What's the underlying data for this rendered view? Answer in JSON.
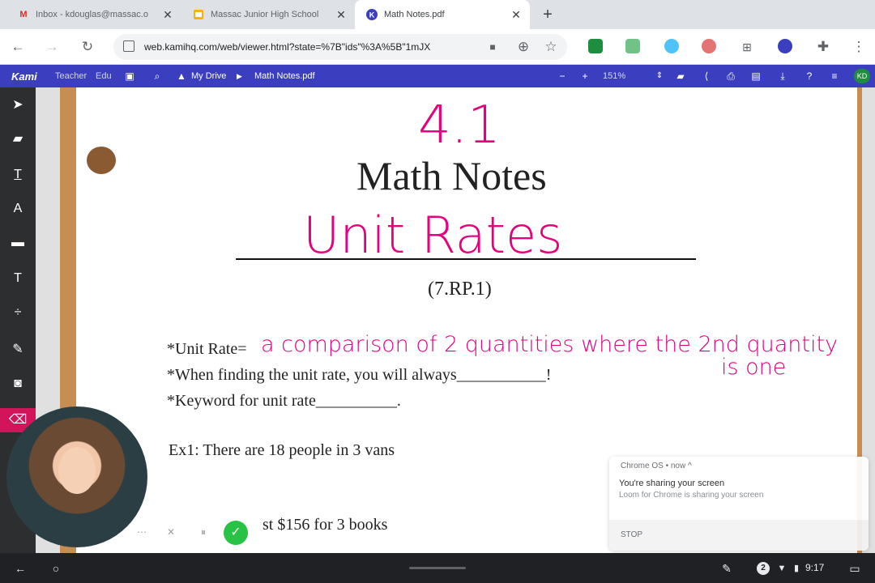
{
  "browser": {
    "tabs": [
      {
        "title": "Inbox - kdouglas@massac.o",
        "icon": "gmail-icon",
        "active": false
      },
      {
        "title": "Massac Junior High School",
        "icon": "google-sites-icon",
        "active": false
      },
      {
        "title": "Math Notes.pdf",
        "icon": "kami-icon",
        "active": true
      }
    ],
    "url": "web.kamihq.com/web/viewer.html?state=%7B\"ids\"%3A%5B\"1mJX"
  },
  "kami": {
    "logo": "Kami",
    "mode_teacher": "Teacher",
    "mode_edu": "Edu",
    "breadcrumb_root": "My Drive",
    "breadcrumb_file": "Math Notes.pdf",
    "zoom": "151%",
    "user_initials": "KD"
  },
  "document": {
    "lesson_number": "4.1",
    "heading": "Math Notes",
    "topic": "Unit Rates",
    "standard": "(7.RP.1)",
    "line1_label": "*Unit Rate=",
    "line1_answer": "a comparison of 2 quantities where the 2nd quantity",
    "line1_answer_cont": "is one",
    "line2": "*When finding the unit rate, you will always___________!",
    "line3": "*Keyword for unit rate__________.",
    "ex1": "Ex1:  There are 18 people in 3 vans",
    "ex2": "st $156 for 3 books"
  },
  "notification": {
    "source": "Chrome OS • now ^",
    "title": "You're sharing your screen",
    "message": "Loom for Chrome is sharing your screen",
    "action": "STOP"
  },
  "shelf": {
    "notification_count": "2",
    "time": "9:17"
  },
  "colors": {
    "kami_bar": "#3b3fbf",
    "ink": "#e6007e",
    "rail": "#2d2e30",
    "wood": "#c68e52"
  }
}
